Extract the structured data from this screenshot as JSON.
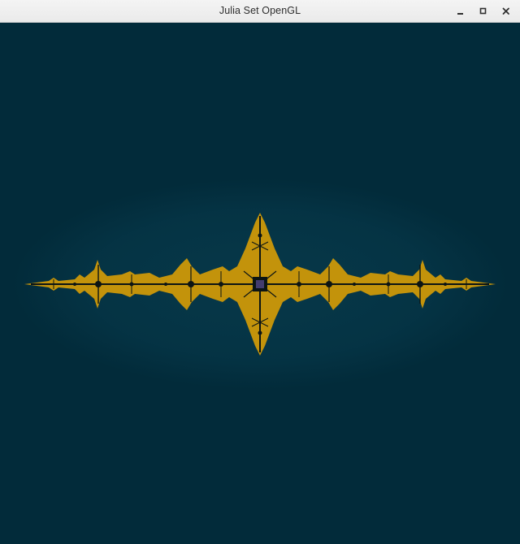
{
  "window": {
    "title": "Julia Set OpenGL"
  },
  "controls": {
    "minimize_icon": "minimize-icon",
    "maximize_icon": "maximize-icon",
    "close_icon": "close-icon"
  },
  "render": {
    "background_color": "#022b3a",
    "halo_color": "#06384a",
    "fractal_color": "#c3930b",
    "core_color": "#0b1414",
    "center_color": "#433c6e"
  }
}
